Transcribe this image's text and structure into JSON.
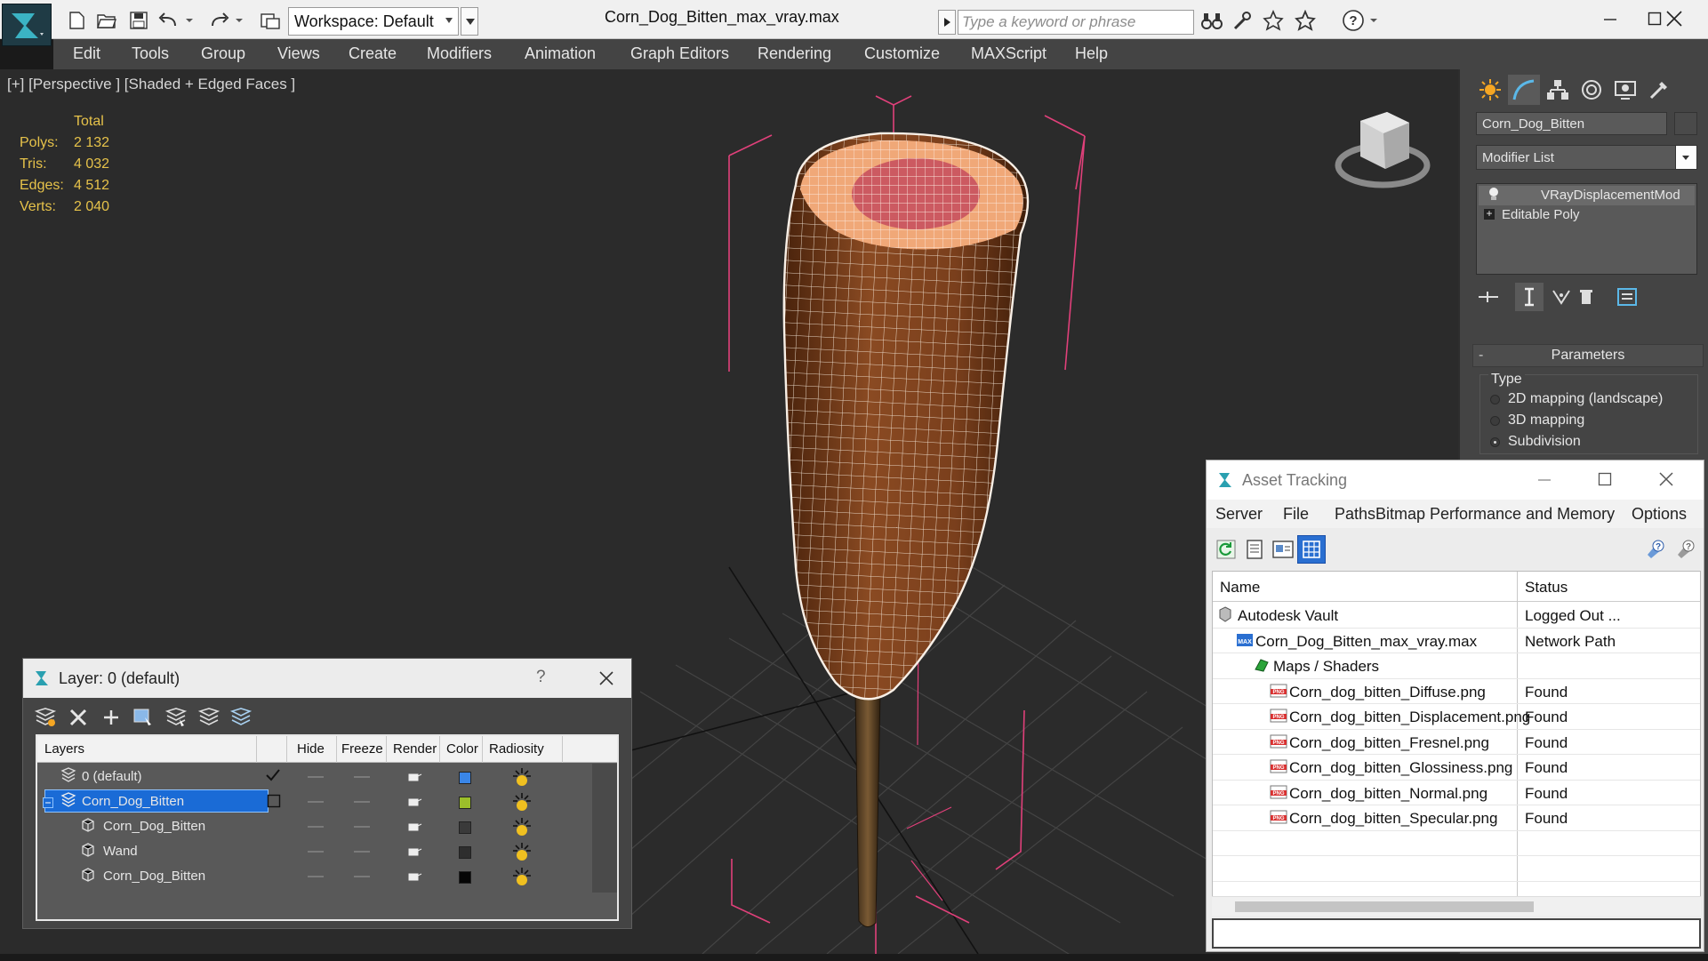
{
  "window": {
    "title": "Corn_Dog_Bitten_max_vray.max",
    "workspace": "Workspace: Default",
    "search_placeholder": "Type a keyword or phrase"
  },
  "menu": [
    "Edit",
    "Tools",
    "Group",
    "Views",
    "Create",
    "Modifiers",
    "Animation",
    "Graph Editors",
    "Rendering",
    "Customize",
    "MAXScript",
    "Help"
  ],
  "viewport": {
    "label": "[+] [Perspective ] [Shaded + Edged Faces ]",
    "stats": {
      "header": "Total",
      "rows": [
        {
          "key": "Polys:",
          "value": "2 132"
        },
        {
          "key": "Tris:",
          "value": "4 032"
        },
        {
          "key": "Edges:",
          "value": "4 512"
        },
        {
          "key": "Verts:",
          "value": "2 040"
        }
      ]
    }
  },
  "command_panel": {
    "object_name": "Corn_Dog_Bitten",
    "modifier_list": "Modifier List",
    "stack": [
      "VRayDisplacementMod",
      "Editable Poly"
    ],
    "rollout": "Parameters",
    "type_group": "Type",
    "type_options": [
      {
        "label": "2D mapping (landscape)",
        "selected": false
      },
      {
        "label": "3D mapping",
        "selected": false
      },
      {
        "label": "Subdivision",
        "selected": true
      }
    ]
  },
  "layer_window": {
    "title": "Layer: 0 (default)",
    "help": "?",
    "columns": [
      "Layers",
      "Hide",
      "Freeze",
      "Render",
      "Color",
      "Radiosity"
    ],
    "rows": [
      {
        "name": "0 (default)",
        "color": "#3a86e8",
        "current": true
      },
      {
        "name": "Corn_Dog_Bitten",
        "color": "#9cbf2a",
        "selected": true
      },
      {
        "name": "Corn_Dog_Bitten",
        "color": "#3a3a3a"
      },
      {
        "name": "Wand",
        "color": "#2e2e2e"
      },
      {
        "name": "Corn_Dog_Bitten",
        "color": "#050505"
      }
    ]
  },
  "asset_window": {
    "title": "Asset Tracking",
    "menu": [
      "Server",
      "File",
      "Paths",
      "Bitmap Performance and Memory",
      "Options"
    ],
    "columns": [
      "Name",
      "Status"
    ],
    "rows": [
      {
        "name": "Autodesk Vault",
        "status": "Logged Out ...",
        "icon": "vault-icon"
      },
      {
        "name": "Corn_Dog_Bitten_max_vray.max",
        "status": "Network Path",
        "icon": "max-file-icon"
      },
      {
        "name": "Maps / Shaders",
        "status": "",
        "icon": "maps-folder-icon"
      },
      {
        "name": "Corn_dog_bitten_Diffuse.png",
        "status": "Found",
        "icon": "png-icon"
      },
      {
        "name": "Corn_dog_bitten_Displacement.png",
        "status": "Found",
        "icon": "png-icon"
      },
      {
        "name": "Corn_dog_bitten_Fresnel.png",
        "status": "Found",
        "icon": "png-icon"
      },
      {
        "name": "Corn_dog_bitten_Glossiness.png",
        "status": "Found",
        "icon": "png-icon"
      },
      {
        "name": "Corn_dog_bitten_Normal.png",
        "status": "Found",
        "icon": "png-icon"
      },
      {
        "name": "Corn_dog_bitten_Specular.png",
        "status": "Found",
        "icon": "png-icon"
      }
    ]
  },
  "colors": {
    "menubar_bg": "#444444",
    "viewport_bg": "#2b2b2b",
    "stats_text": "#e6c24a",
    "selection_blue": "#1a6bd6",
    "corn_dog_brown": "#7a3f1c",
    "gizmo_pink": "#e0407a"
  }
}
